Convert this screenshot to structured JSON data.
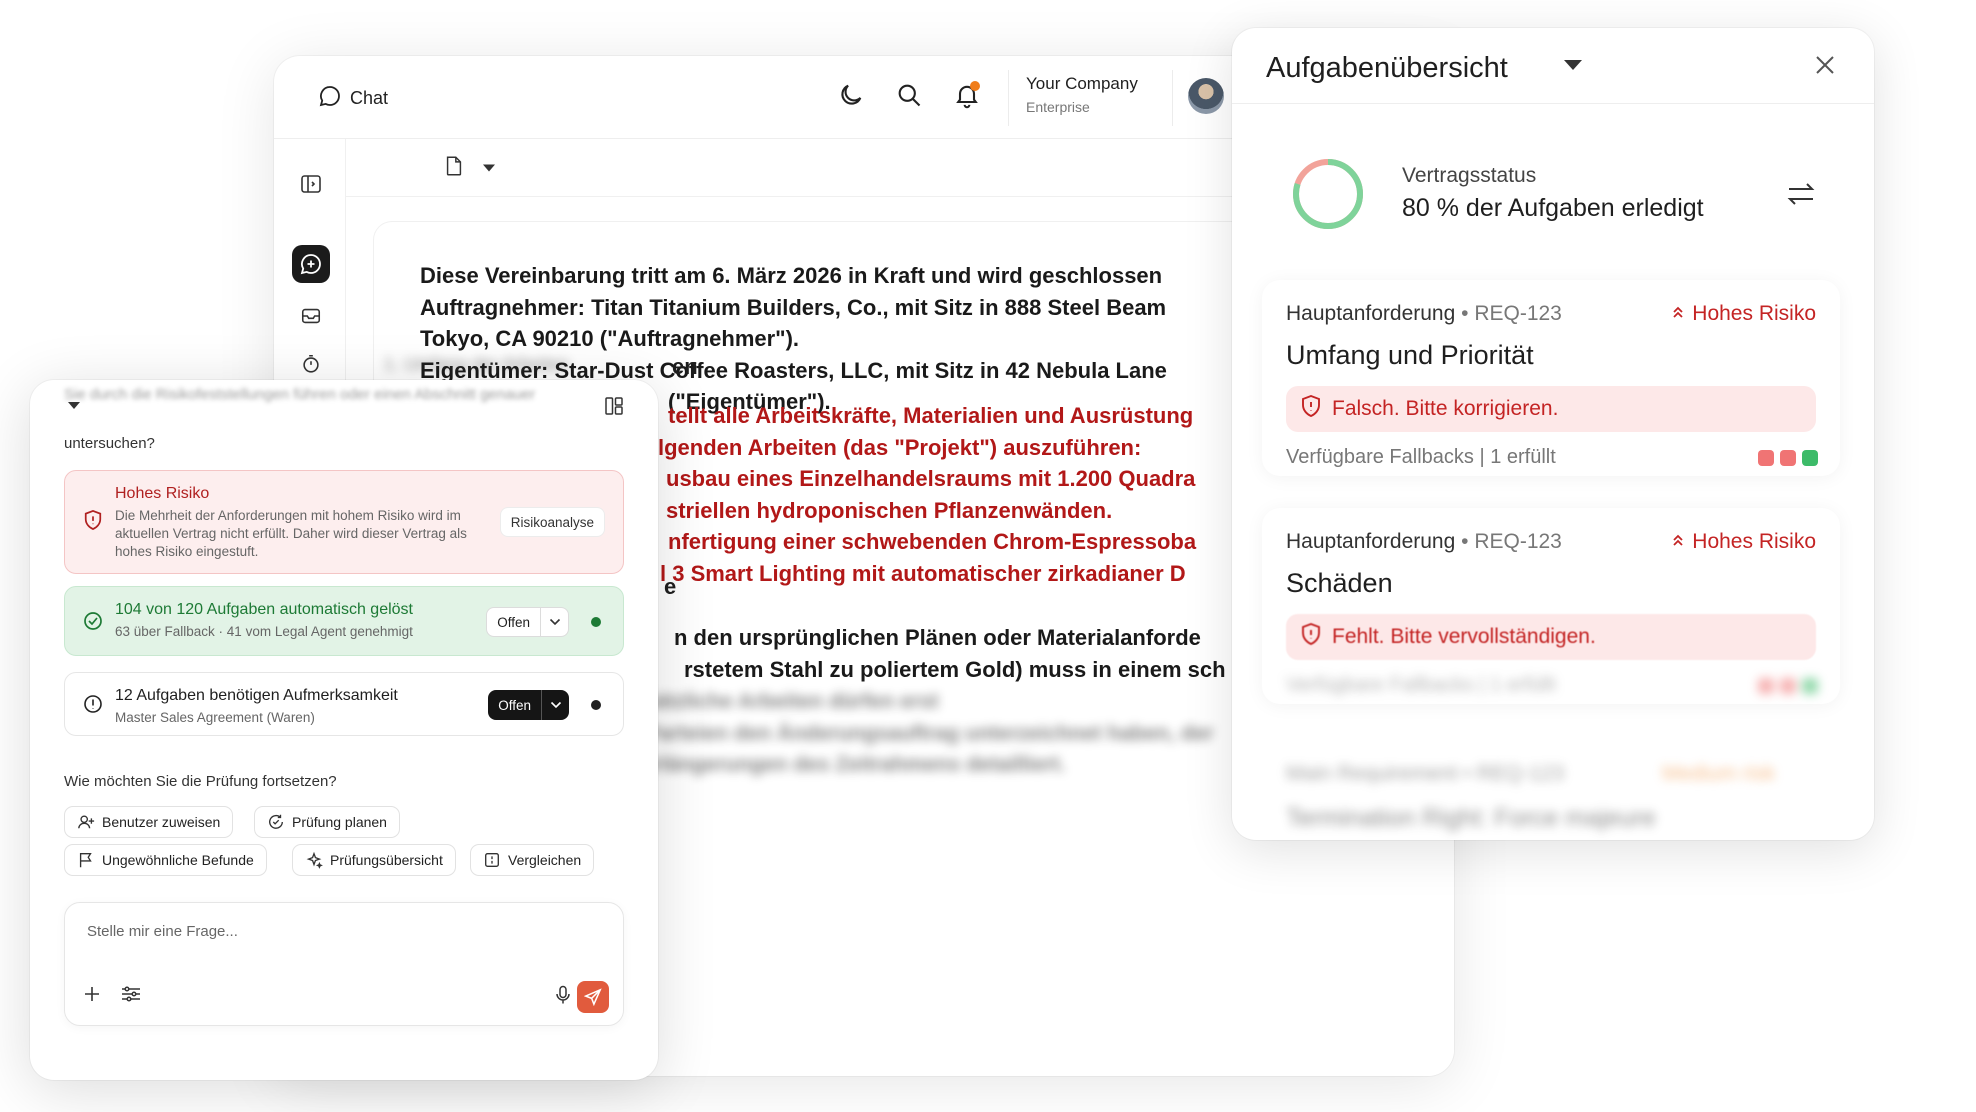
{
  "topbar": {
    "chat_label": "Chat",
    "company_name": "Your Company",
    "company_plan": "Enterprise"
  },
  "document": {
    "paragraph": [
      "Diese Vereinbarung tritt am 6. März 2026 in Kraft und wird geschlossen",
      "Auftragnehmer: Titan Titanium Builders, Co., mit Sitz in 888 Steel Beam",
      "Tokyo, CA 90210 (\"Auftragnehmer\").",
      "Eigentümer: Star-Dust Coffee Roasters, LLC, mit Sitz in 42 Nebula Lane",
      "(\"Eigentümer\")."
    ],
    "heading_1_suffix": "en",
    "red_lines": [
      "tellt alle Arbeitskräfte, Materialien und Ausrüstung",
      "lgenden Arbeiten (das \"Projekt\") auszuführen:",
      "usbau eines Einzelhandelsraums mit 1.200 Quadra",
      "striellen hydroponischen Pflanzenwänden.",
      "nfertigung einer schwebenden Chrom-Espressoba",
      "l 3 Smart Lighting mit automatischer zirkadianer D"
    ],
    "heading_2_suffix": "e",
    "black_lines": [
      "n den ursprünglichen Plänen oder Materialanforde",
      "rstetem Stahl zu poliertem Gold) muss in einem sch"
    ]
  },
  "task_panel": {
    "title": "Aufgabenübersicht",
    "status_label": "Vertragsstatus",
    "status_value": "80 % der Aufgaben erledigt",
    "progress": 0.8,
    "colors": {
      "progress": "#7fd39a",
      "remaining": "#f2a39a",
      "risk": "#c42424"
    },
    "requirements": [
      {
        "kind": "Hauptanforderung",
        "id": "REQ-123",
        "risk": "Hohes Risiko",
        "title": "Umfang und Priorität",
        "alert": "Falsch. Bitte korrigieren.",
        "fallbacks": "Verfügbare Fallbacks | 1 erfüllt"
      },
      {
        "kind": "Hauptanforderung",
        "id": "REQ-123",
        "risk": "Hohes Risiko",
        "title": "Schäden",
        "alert": "Fehlt. Bitte vervollständigen."
      }
    ]
  },
  "chat_panel": {
    "intro": "untersuchen?",
    "risk_card": {
      "title": "Hohes Risiko",
      "text": "Die Mehrheit der Anforderungen mit hohem Risiko wird im aktuellen Vertrag nicht erfüllt. Daher wird dieser Vertrag als hohes Risiko eingestuft.",
      "button": "Risikoanalyse"
    },
    "solved_card": {
      "title": "104 von 120 Aufgaben automatisch gelöst",
      "subtitle": "63 über Fallback · 41 vom Legal Agent genehmigt",
      "button": "Offen"
    },
    "attention_card": {
      "title": "12 Aufgaben benötigen Aufmerksamkeit",
      "subtitle": "Master Sales Agreement (Waren)",
      "button": "Offen"
    },
    "question": "Wie möchten Sie die Prüfung fortsetzen?",
    "chips": [
      "Benutzer zuweisen",
      "Prüfung planen",
      "Ungewöhnliche Befunde",
      "Prüfungsübersicht",
      "Vergleichen"
    ],
    "input_placeholder": "Stelle mir eine Frage..."
  }
}
